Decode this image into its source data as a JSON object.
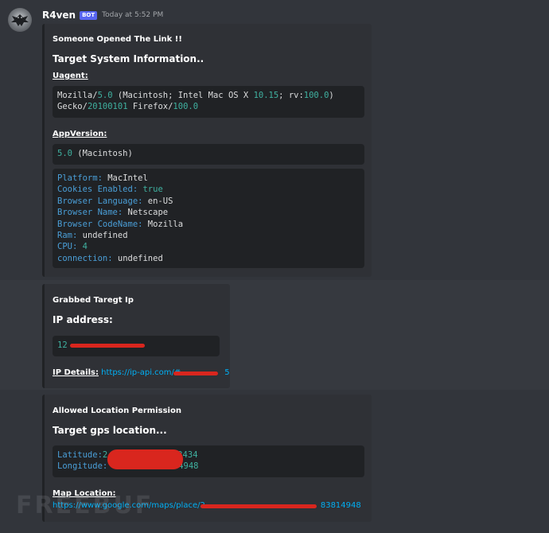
{
  "message": {
    "username": "R4ven",
    "bot_tag": "BOT",
    "timestamp": "Today at 5:52 PM"
  },
  "embed1": {
    "author": "Someone Opened The Link !!",
    "title": "Target System Information..",
    "uagent_label": "Uagent:",
    "uagent_line1": {
      "a": "Mozilla/",
      "b": "5.0",
      "c": " (Macintosh; Intel Mac OS X ",
      "d": "10.15",
      "e": "; rv:",
      "f": "100.0",
      "g": ")"
    },
    "uagent_line2": {
      "a": "Gecko/",
      "b": "20100101",
      "c": " Firefox/",
      "d": "100.0"
    },
    "appversion_label": "AppVersion:",
    "appversion": {
      "a": "5.0",
      "b": " (Macintosh)"
    },
    "system": [
      {
        "key": "Platform:",
        "value": " MacIntel",
        "numeric": false
      },
      {
        "key": "Cookies Enabled:",
        "value": " true",
        "numeric": true
      },
      {
        "key": "Browser Language:",
        "value": " en-US",
        "numeric": false
      },
      {
        "key": "Browser Name:",
        "value": " Netscape",
        "numeric": false
      },
      {
        "key": "Browser CodeName:",
        "value": " Mozilla",
        "numeric": false
      },
      {
        "key": "Ram:",
        "value": " undefined",
        "numeric": false
      },
      {
        "key": "CPU:",
        "value": " 4",
        "numeric": true
      },
      {
        "key": "connection:",
        "value": " undefined",
        "numeric": false
      }
    ]
  },
  "embed2": {
    "author": "Grabbed Taregt Ip",
    "title": "IP address:",
    "ip_prefix": "12",
    "ip_details_label": "IP Details:",
    "ip_details_link": "https://ip-api.com/#",
    "ip_details_tail": "5"
  },
  "embed3": {
    "author": "Allowed Location Permission",
    "title": "Target gps location...",
    "latitude_label": "Latitude:",
    "latitude_prefix": "2",
    "latitude_tail": "3434",
    "longitude_label": "Longitude:",
    "longitude_tail": "4948",
    "map_label": "Map Location:",
    "map_link": "https://www.google.com/maps/place/2",
    "map_tail": "83814948"
  },
  "watermark": "FREEBUF",
  "colors": {
    "background": "#36393f",
    "embed": "#2f3136",
    "code": "#202225",
    "key": "#4a9fd8",
    "number": "#3fb1a0",
    "link": "#00aff4",
    "redaction": "#d9261e",
    "bot_tag": "#5865f2"
  }
}
